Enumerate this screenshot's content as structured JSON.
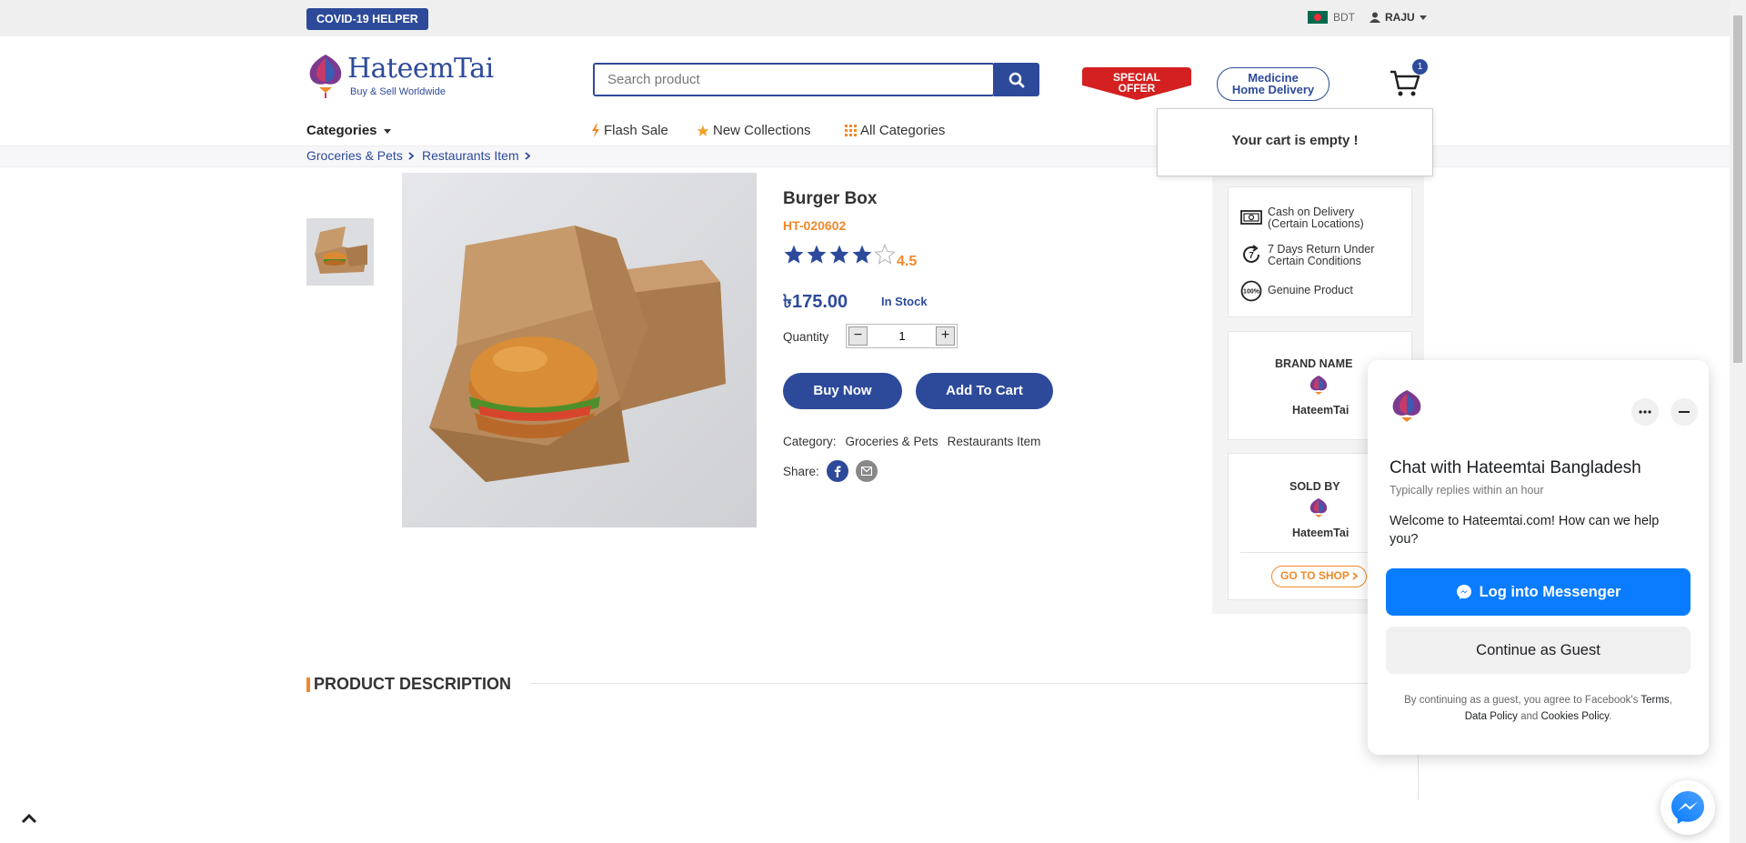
{
  "topbar": {
    "covid_label": "COVID-19 HELPER",
    "currency": "BDT",
    "user": "RAJU"
  },
  "header": {
    "logo_text": "HateemTai",
    "logo_tagline": "Buy & Sell Worldwide",
    "search_placeholder": "Search product",
    "special_offer": [
      "SPECIAL",
      "OFFER"
    ],
    "medicine": [
      "Medicine",
      "Home Delivery"
    ],
    "cart_count": "1",
    "cart_empty": "Your cart is empty !"
  },
  "nav": {
    "categories": "Categories",
    "flash_sale": "Flash Sale",
    "new_collections": "New Collections",
    "all_categories": "All Categories"
  },
  "breadcrumb": [
    "Groceries & Pets",
    "Restaurants Item"
  ],
  "product": {
    "title": "Burger Box",
    "sku": "HT-020602",
    "rating": "4.5",
    "rating_value": 4.5,
    "rating_max": 5,
    "price": "৳175.00",
    "stock": "In Stock",
    "quantity_label": "Quantity",
    "quantity": "1",
    "buy_now": "Buy Now",
    "add_to_cart": "Add To Cart",
    "category_label": "Category:",
    "categories": [
      "Groceries & Pets",
      "Restaurants Item"
    ],
    "share_label": "Share:"
  },
  "sidebar": {
    "features": [
      {
        "icon": "cash-icon",
        "line1": "Cash on Delivery",
        "line2": "(Certain Locations)"
      },
      {
        "icon": "return-7-icon",
        "line1": "7 Days Return Under",
        "line2": "Certain Conditions"
      },
      {
        "icon": "genuine-100-icon",
        "line1": "Genuine Product",
        "line2": ""
      }
    ],
    "brand_title": "BRAND NAME",
    "brand_name": "HateemTai",
    "sold_title": "SOLD BY",
    "seller_name": "HateemTai",
    "go_to_shop": "GO TO SHOP"
  },
  "description": {
    "heading": "PRODUCT DESCRIPTION"
  },
  "chat": {
    "title": "Chat with Hateemtai Bangladesh",
    "subtitle": "Typically replies within an hour",
    "welcome": "Welcome to Hateemtai.com! How can we help you?",
    "login_button": "Log into Messenger",
    "guest_button": "Continue as Guest",
    "legal_prefix": "By continuing as a guest, you agree to Facebook's",
    "terms": "Terms",
    "data_policy": "Data Policy",
    "and": "and",
    "cookies_policy": "Cookies Policy"
  },
  "colors": {
    "brand_blue": "#2d4a9a",
    "accent_orange": "#f0892b",
    "offer_red": "#d42020",
    "messenger_blue": "#0a7cff"
  }
}
